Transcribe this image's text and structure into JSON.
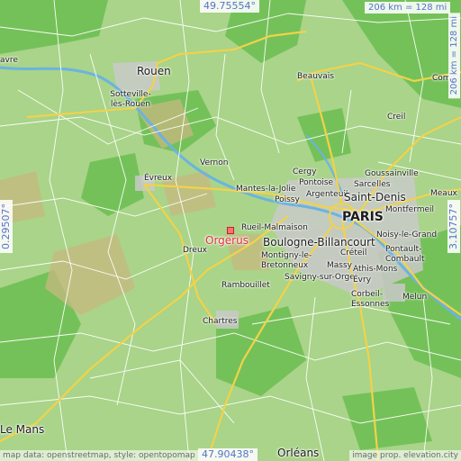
{
  "map": {
    "coords": {
      "top": "49.75554°",
      "bottom": "47.90438°",
      "left": "0.29507°",
      "right": "3.10757°"
    },
    "scale": {
      "top": "206 km = 128 mi",
      "right": "206 km = 128 mi"
    },
    "attribution": {
      "left": "map data: openstreetmap, style: opentopomap",
      "right": "image prop. elevation.city"
    },
    "target": "Orgerus",
    "cities": [
      "Rouen",
      "Sotteville-lès-Rouen",
      "Beauvais",
      "Compiègne",
      "Creil",
      "Vernon",
      "Évreux",
      "Cergy",
      "Pontoise",
      "Mantes-la-Jolie",
      "Poissy",
      "Argenteuil",
      "Sarcelles",
      "Goussainville",
      "Saint-Denis",
      "Meaux",
      "PARIS",
      "Montfermeil",
      "Rueil-Malmaison",
      "Boulogne-Billancourt",
      "Noisy-le-Grand",
      "Créteil",
      "Pontault-Combault",
      "Montigny-le-Bretonneux",
      "Massy",
      "Athis-Mons",
      "Dreux",
      "Savigny-sur-Orge",
      "Rambouillet",
      "Évry",
      "Corbeil-Essonnes",
      "Melun",
      "Chartres",
      "Orléans",
      "Le Mans",
      "avre",
      "Comp"
    ],
    "colors": {
      "land": "#a9d489",
      "forest": "#6fbf54",
      "highland": "#c7b880",
      "urban": "#c9c9c9",
      "highway": "#f2d24a",
      "road": "#ffffff",
      "water": "#6bb3e0",
      "target": "#e0323a",
      "coord_text": "#5573c8"
    }
  }
}
